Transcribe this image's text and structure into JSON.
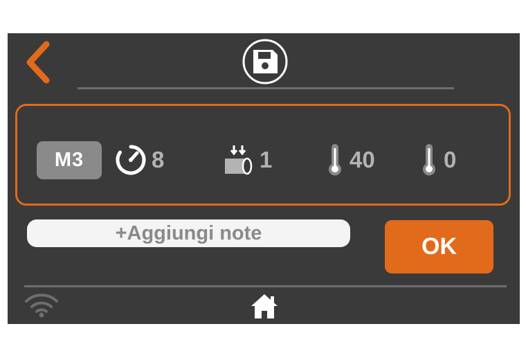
{
  "header": {
    "back_icon": "chevron-left-icon",
    "save_icon": "floppy-disk-icon"
  },
  "recipe": {
    "mode": "M3",
    "time": {
      "icon": "timer-icon",
      "value": "8"
    },
    "stirring": {
      "icon": "stirring-pressure-icon",
      "value": "1"
    },
    "temperature_1": {
      "icon": "thermometer-icon",
      "value": "40"
    },
    "temperature_2": {
      "icon": "thermometer-icon",
      "value": "0"
    }
  },
  "notes": {
    "label": "+Aggiungi note"
  },
  "actions": {
    "ok_label": "OK"
  },
  "footer": {
    "wifi_icon": "wifi-icon",
    "home_icon": "home-icon"
  },
  "colors": {
    "accent": "#e26a1b",
    "background": "#3a3a3a",
    "muted_text": "#b3b3b3",
    "badge": "#8a8a8a"
  }
}
